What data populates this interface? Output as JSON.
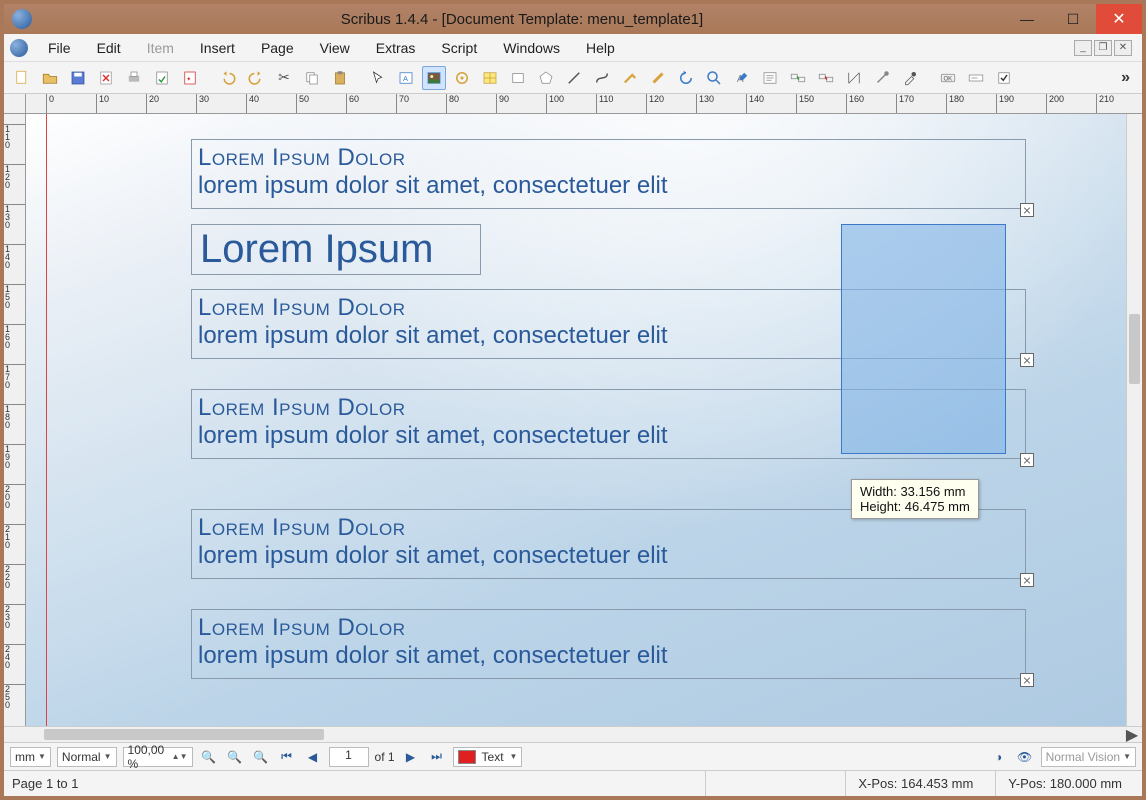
{
  "title": "Scribus 1.4.4 - [Document Template: menu_template1]",
  "menus": [
    "File",
    "Edit",
    "Item",
    "Insert",
    "Page",
    "View",
    "Extras",
    "Script",
    "Windows",
    "Help"
  ],
  "disabled_menus": [
    "Item"
  ],
  "textframes": [
    {
      "heading": "Lorem Ipsum Dolor",
      "body": "lorem ipsum dolor sit amet, consectetuer elit"
    },
    {
      "heading": "Lorem Ipsum Dolor",
      "body": "lorem ipsum dolor sit amet, consectetuer elit"
    },
    {
      "heading": "Lorem Ipsum Dolor",
      "body": "lorem ipsum dolor sit amet, consectetuer elit"
    },
    {
      "heading": "Lorem Ipsum Dolor",
      "body": "lorem ipsum dolor sit amet, consectetuer elit"
    },
    {
      "heading": "Lorem Ipsum Dolor",
      "body": "lorem ipsum dolor sit amet, consectetuer elit"
    }
  ],
  "bigtitle": "Lorem Ipsum",
  "tooltip": {
    "l1": "Width: 33.156 mm",
    "l2": "Height: 46.475 mm"
  },
  "bottombar": {
    "unit": "mm",
    "preview": "Normal",
    "zoom": "100,00 %",
    "page": "1",
    "pages_of": "of 1",
    "layer": "Text",
    "vision": "Normal Vision"
  },
  "status": {
    "pages": "Page 1 to 1",
    "xlabel": "X-Pos:",
    "x": "164.453 mm",
    "ylabel": "Y-Pos:",
    "y": "180.000 mm"
  },
  "ruler_h": [
    0,
    10,
    20,
    30,
    40,
    50,
    60,
    70,
    80,
    90,
    100,
    110,
    120,
    130,
    140,
    150,
    160,
    170,
    180,
    190,
    200,
    210
  ],
  "ruler_v": [
    110,
    120,
    130,
    140,
    150,
    160,
    170,
    180,
    190,
    200,
    210,
    220,
    230,
    240,
    250
  ]
}
